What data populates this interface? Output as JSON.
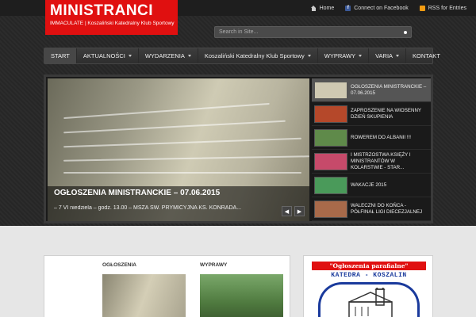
{
  "topbar": {
    "links": [
      {
        "label": "Home",
        "icon": "home-icon"
      },
      {
        "label": "Connect on Facebook",
        "icon": "facebook-icon"
      },
      {
        "label": "RSS for Entries",
        "icon": "rss-icon"
      }
    ]
  },
  "logo": {
    "title": "MINISTRANCI",
    "subtitle": "IMMACULATE | Koszaliński Katedralny Klub Sportowy"
  },
  "search": {
    "placeholder": "Search in Site..."
  },
  "nav": {
    "items": [
      {
        "label": "START",
        "dropdown": false
      },
      {
        "label": "AKTUALNOŚCI",
        "dropdown": true
      },
      {
        "label": "WYDARZENIA",
        "dropdown": true
      },
      {
        "label": "Koszaliński Katedralny Klub Sportowy",
        "dropdown": true
      },
      {
        "label": "WYPRAWY",
        "dropdown": true
      },
      {
        "label": "VARIA",
        "dropdown": true
      },
      {
        "label": "KONTAKT",
        "dropdown": false
      }
    ]
  },
  "slider": {
    "title": "OGŁOSZENIA MINISTRANCKIE – 07.06.2015",
    "excerpt": "– 7 VI niedziela – godz. 13.00 – MSZA ŚW. PRYMICYJNA KS. KONRADA...",
    "prev_label": "◀",
    "next_label": "▶",
    "thumbs": [
      {
        "label": "OGŁOSZENIA MINISTRANCKIE – 07.06.2015",
        "color": "#cfc9b2",
        "active": true
      },
      {
        "label": "ZAPROSZENIE NA WIOSENNY DZIEŃ SKUPIENIA",
        "color": "#b5482a",
        "active": false
      },
      {
        "label": "ROWEREM DO ALBANII !!!",
        "color": "#5f8a4a",
        "active": false
      },
      {
        "label": "I MISTRZOSTWA KSIĘŻY I MINISTRANTÓW W KOLARSTWIE - STAR...",
        "color": "#c64a6a",
        "active": false
      },
      {
        "label": "WAKACJE 2015",
        "color": "#4a9a5a",
        "active": false
      },
      {
        "label": "WALECZNI DO KOŃCA - PÓŁFINAŁ LIGI DIECEZJALNEJ",
        "color": "#a86a4a",
        "active": false
      }
    ]
  },
  "columns": [
    {
      "heading": "OGŁOSZENIA",
      "color": "#c8c1a5"
    },
    {
      "heading": "WYPRAWY",
      "color": "#4f7a3f"
    }
  ],
  "parish": {
    "banner": "\"Ogłoszenia parafialne\"",
    "subtitle": "KATEDRA - KOSZALIN"
  },
  "colors": {
    "brand_red": "#e01010",
    "crest_blue": "#1a3a9c"
  }
}
